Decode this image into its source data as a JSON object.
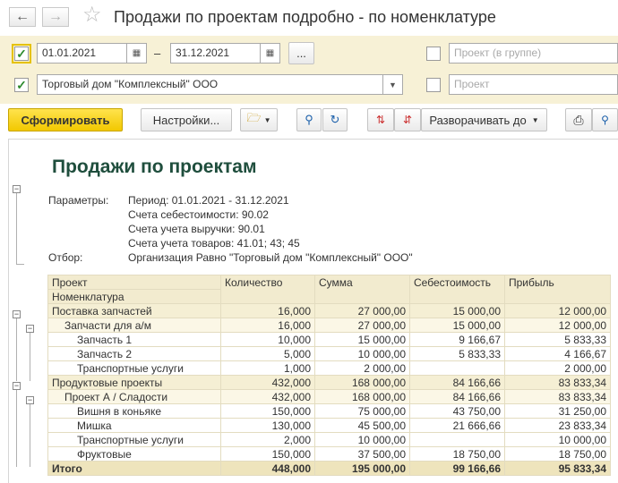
{
  "header": {
    "title": "Продажи по проектам подробно - по номенклатуре",
    "back_icon": "arrow-left-icon",
    "forward_icon": "arrow-right-icon",
    "favorite_icon": "star-icon"
  },
  "filters": {
    "date_from": "01.01.2021",
    "date_sep": "–",
    "date_to": "31.12.2021",
    "more_label": "...",
    "organization": "Торговый дом \"Комплексный\" ООО",
    "project_group_placeholder": "Проект (в группе)",
    "project_placeholder": "Проект"
  },
  "toolbar": {
    "generate_label": "Сформировать",
    "settings_label": "Настройки...",
    "expand_label": "Разворачивать до"
  },
  "report": {
    "title": "Продажи по проектам",
    "params_label": "Параметры:",
    "params": [
      "Период: 01.01.2021 - 31.12.2021",
      "Счета себестоимости: 90.02",
      "Счета учета выручки: 90.01",
      "Счета учета товаров: 41.01; 43; 45"
    ],
    "filter_label": "Отбор:",
    "filter_value": "Организация Равно \"Торговый дом \"Комплексный\" ООО\"",
    "columns": {
      "project": "Проект",
      "item": "Номенклатура",
      "qty": "Количество",
      "sum": "Сумма",
      "cost": "Себестоимость",
      "profit": "Прибыль"
    },
    "rows": [
      {
        "level": 0,
        "name": "Поставка запчастей",
        "qty": "16,000",
        "sum": "27 000,00",
        "cost": "15 000,00",
        "profit": "12 000,00"
      },
      {
        "level": 1,
        "name": "Запчасти для а/м",
        "qty": "16,000",
        "sum": "27 000,00",
        "cost": "15 000,00",
        "profit": "12 000,00"
      },
      {
        "level": 2,
        "name": "Запчасть 1",
        "qty": "10,000",
        "sum": "15 000,00",
        "cost": "9 166,67",
        "profit": "5 833,33"
      },
      {
        "level": 2,
        "name": "Запчасть 2",
        "qty": "5,000",
        "sum": "10 000,00",
        "cost": "5 833,33",
        "profit": "4 166,67"
      },
      {
        "level": 2,
        "name": "Транспортные услуги",
        "qty": "1,000",
        "sum": "2 000,00",
        "cost": "",
        "profit": "2 000,00"
      },
      {
        "level": 0,
        "name": "Продуктовые проекты",
        "qty": "432,000",
        "sum": "168 000,00",
        "cost": "84 166,66",
        "profit": "83 833,34"
      },
      {
        "level": 1,
        "name": "Проект А / Сладости",
        "qty": "432,000",
        "sum": "168 000,00",
        "cost": "84 166,66",
        "profit": "83 833,34"
      },
      {
        "level": 2,
        "name": "Вишня в коньяке",
        "qty": "150,000",
        "sum": "75 000,00",
        "cost": "43 750,00",
        "profit": "31 250,00"
      },
      {
        "level": 2,
        "name": "Мишка",
        "qty": "130,000",
        "sum": "45 500,00",
        "cost": "21 666,66",
        "profit": "23 833,34"
      },
      {
        "level": 2,
        "name": "Транспортные услуги",
        "qty": "2,000",
        "sum": "10 000,00",
        "cost": "",
        "profit": "10 000,00"
      },
      {
        "level": 2,
        "name": "Фруктовые",
        "qty": "150,000",
        "sum": "37 500,00",
        "cost": "18 750,00",
        "profit": "18 750,00"
      }
    ],
    "total": {
      "name": "Итого",
      "qty": "448,000",
      "sum": "195 000,00",
      "cost": "99 166,66",
      "profit": "95 833,34"
    }
  }
}
